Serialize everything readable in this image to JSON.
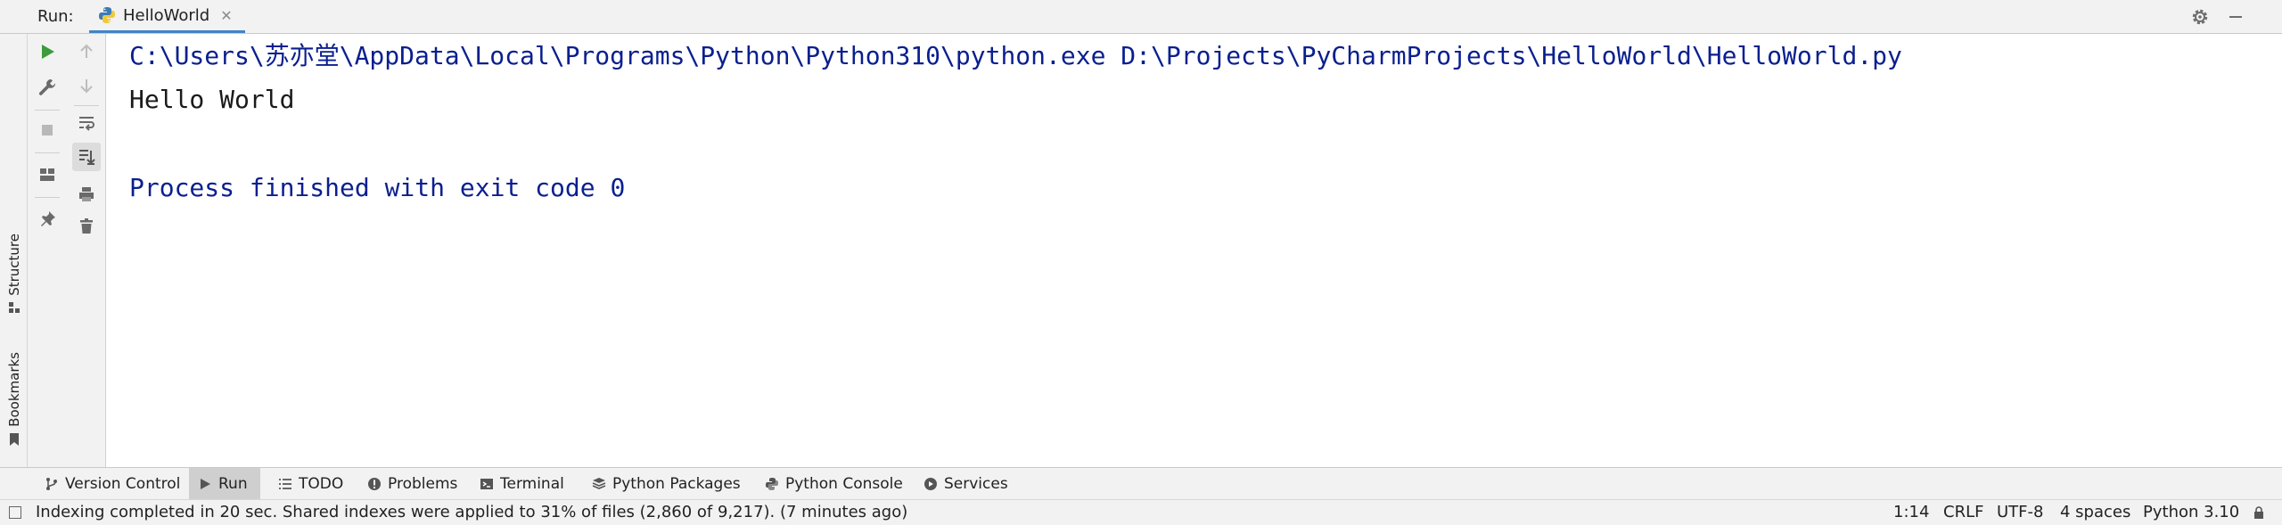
{
  "run_panel": {
    "label": "Run:",
    "tab_label": "HelloWorld"
  },
  "side_tabs": {
    "structure": "Structure",
    "bookmarks": "Bookmarks"
  },
  "console": {
    "command_line": "C:\\Users\\苏亦堂\\AppData\\Local\\Programs\\Python\\Python310\\python.exe D:\\Projects\\PyCharmProjects\\HelloWorld\\HelloWorld.py",
    "output_line": "Hello World",
    "exit_line": "Process finished with exit code 0"
  },
  "tool_windows": [
    {
      "label": "Version Control",
      "icon": "branch-icon"
    },
    {
      "label": "Run",
      "icon": "run-icon",
      "selected": true
    },
    {
      "label": "TODO",
      "icon": "list-icon"
    },
    {
      "label": "Problems",
      "icon": "problems-icon"
    },
    {
      "label": "Terminal",
      "icon": "terminal-icon"
    },
    {
      "label": "Python Packages",
      "icon": "packages-icon"
    },
    {
      "label": "Python Console",
      "icon": "python-console-icon"
    },
    {
      "label": "Services",
      "icon": "services-icon"
    }
  ],
  "status_bar": {
    "message": "Indexing completed in 20 sec. Shared indexes were applied to 31% of files (2,860 of 9,217). (7 minutes ago)",
    "caret_position": "1:14",
    "line_separator": "CRLF",
    "encoding": "UTF-8",
    "indent": "4 spaces",
    "interpreter": "Python 3.10"
  },
  "colors": {
    "run_green": "#3c9b3c",
    "console_blue": "#0a1f8f",
    "tab_underline": "#4083c9"
  }
}
